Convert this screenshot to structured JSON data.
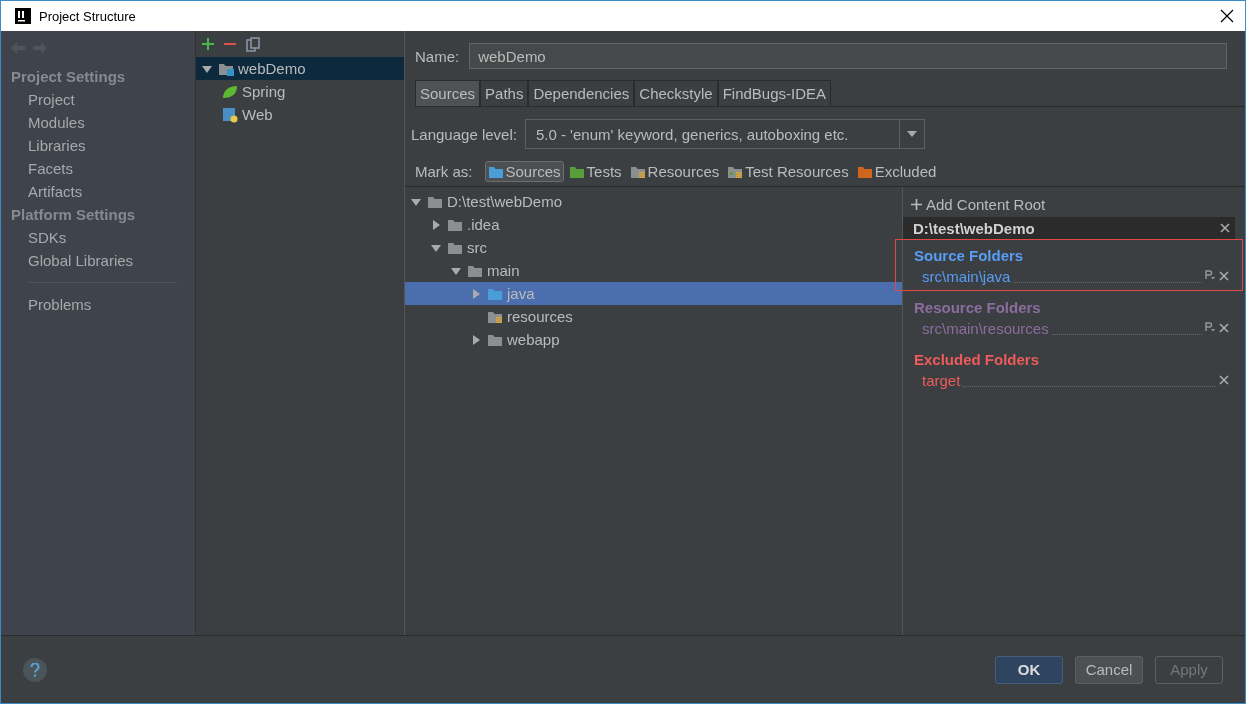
{
  "window": {
    "title": "Project Structure"
  },
  "sidebar": {
    "sections": [
      {
        "heading": "Project Settings",
        "items": [
          {
            "label": "Project"
          },
          {
            "label": "Modules"
          },
          {
            "label": "Libraries"
          },
          {
            "label": "Facets"
          },
          {
            "label": "Artifacts"
          }
        ]
      },
      {
        "heading": "Platform Settings",
        "items": [
          {
            "label": "SDKs"
          },
          {
            "label": "Global Libraries"
          }
        ]
      }
    ],
    "footer_items": [
      {
        "label": "Problems"
      }
    ]
  },
  "modules": {
    "tree": [
      {
        "label": "webDemo",
        "kind": "module",
        "expanded": true,
        "selected": true,
        "children": [
          {
            "label": "Spring",
            "kind": "spring",
            "selected": false
          },
          {
            "label": "Web",
            "kind": "web",
            "selected": false
          }
        ]
      }
    ]
  },
  "name": {
    "label": "Name:",
    "value": "webDemo"
  },
  "tabs": [
    {
      "label": "Sources",
      "selected": true
    },
    {
      "label": "Paths",
      "selected": false
    },
    {
      "label": "Dependencies",
      "selected": false
    },
    {
      "label": "Checkstyle",
      "selected": false
    },
    {
      "label": "FindBugs-IDEA",
      "selected": false
    }
  ],
  "language_level": {
    "label": "Language level:",
    "value": "5.0 - 'enum' keyword, generics, autoboxing etc."
  },
  "mark_as": {
    "label": "Mark as:",
    "options": [
      {
        "label": "Sources",
        "kind": "sources",
        "selected": true
      },
      {
        "label": "Tests",
        "kind": "tests",
        "selected": false
      },
      {
        "label": "Resources",
        "kind": "resources",
        "selected": false
      },
      {
        "label": "Test Resources",
        "kind": "test_resources",
        "selected": false
      },
      {
        "label": "Excluded",
        "kind": "excluded",
        "selected": false
      }
    ]
  },
  "file_tree": [
    {
      "label": "D:\\test\\webDemo",
      "kind": "folder",
      "expanded": true,
      "selected": false,
      "children": [
        {
          "label": ".idea",
          "kind": "folder",
          "expanded": false,
          "selected": false
        },
        {
          "label": "src",
          "kind": "folder",
          "expanded": true,
          "selected": false,
          "children": [
            {
              "label": "main",
              "kind": "folder",
              "expanded": true,
              "selected": false,
              "children": [
                {
                  "label": "java",
                  "kind": "sources",
                  "expanded": false,
                  "selected": true
                },
                {
                  "label": "resources",
                  "kind": "resources",
                  "selected": false
                },
                {
                  "label": "webapp",
                  "kind": "folder",
                  "expanded": false,
                  "selected": false
                }
              ]
            }
          ]
        }
      ]
    }
  ],
  "content_root": {
    "add_label": "Add Content Root",
    "path": "D:\\test\\webDemo",
    "groups": [
      {
        "title": "Source Folders",
        "kind": "sources",
        "color": "#589df6",
        "highlighted": true,
        "folders": [
          {
            "path": "src\\main\\java"
          }
        ]
      },
      {
        "title": "Resource Folders",
        "kind": "resources",
        "color": "#8b6c9e",
        "highlighted": false,
        "folders": [
          {
            "path": "src\\main\\resources"
          }
        ]
      },
      {
        "title": "Excluded Folders",
        "kind": "excluded",
        "color": "#ee5b5b",
        "highlighted": false,
        "folders": [
          {
            "path": "target"
          }
        ]
      }
    ]
  },
  "buttons": [
    {
      "label": "OK",
      "kind": "default"
    },
    {
      "label": "Cancel",
      "kind": "normal"
    },
    {
      "label": "Apply",
      "kind": "disabled"
    }
  ]
}
